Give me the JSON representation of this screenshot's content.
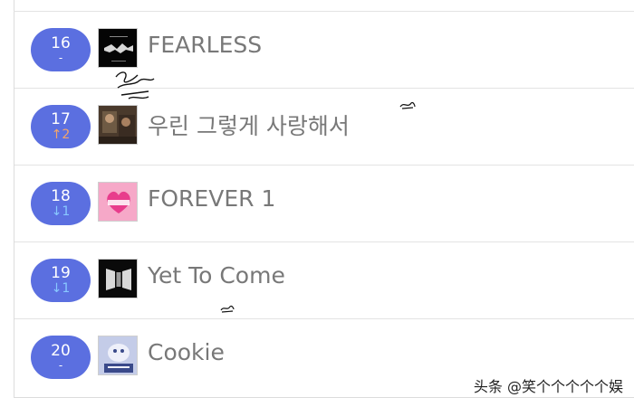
{
  "chart": {
    "rows": [
      {
        "rank": "16",
        "change": "-",
        "change_dir": "same",
        "title": "FEARLESS",
        "cover": "fearless-cover"
      },
      {
        "rank": "17",
        "change": "↑2",
        "change_dir": "up",
        "title": "우린 그렇게 사랑해서",
        "cover": "we-loved-cover"
      },
      {
        "rank": "18",
        "change": "↓1",
        "change_dir": "down",
        "title": "FOREVER 1",
        "cover": "forever1-cover"
      },
      {
        "rank": "19",
        "change": "↓1",
        "change_dir": "down",
        "title": "Yet To Come",
        "cover": "yet-to-come-cover"
      },
      {
        "rank": "20",
        "change": "-",
        "change_dir": "same",
        "title": "Cookie",
        "cover": "cookie-cover"
      }
    ]
  },
  "colors": {
    "pill": "#5b6fe0",
    "up": "#f4a56a",
    "down": "#88c8ff",
    "title": "#787878"
  },
  "watermark": "头条 @笑个个个个个娱"
}
